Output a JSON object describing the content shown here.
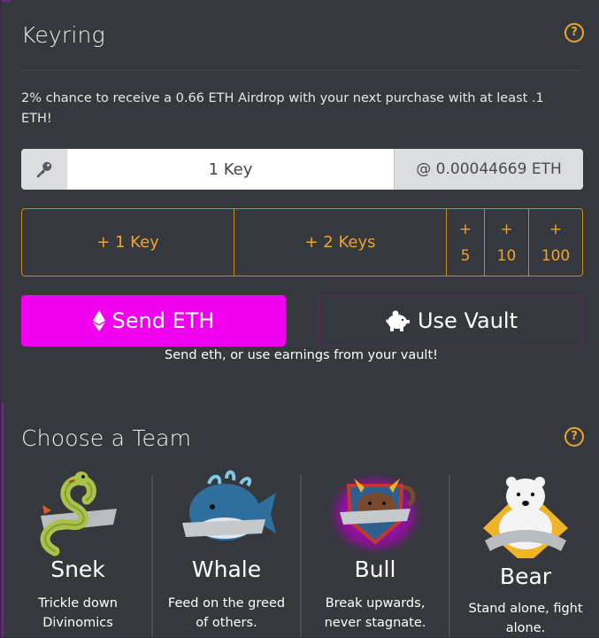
{
  "keyring": {
    "title": "Keyring",
    "help_icon": "question-circle-icon",
    "airdrop_text": "2% chance to receive a 0.66 ETH Airdrop with your next purchase with at least .1 ETH!",
    "key_icon": "key-icon",
    "key_input_value": "1 Key",
    "price_text": "@ 0.00044669 ETH",
    "add_buttons": {
      "one": "+ 1 Key",
      "two": "+ 2 Keys",
      "five_plus": "+",
      "five_num": "5",
      "ten_plus": "+",
      "ten_num": "10",
      "hundred_plus": "+",
      "hundred_num": "100"
    },
    "send_button": "Send ETH",
    "vault_button": "Use Vault",
    "send_note": "Send eth, or use earnings from your vault!"
  },
  "team": {
    "title": "Choose a Team",
    "help_icon": "question-circle-icon",
    "teams": [
      {
        "name": "Snek",
        "desc": "Trickle down Divinomics"
      },
      {
        "name": "Whale",
        "desc": "Feed on the greed of others."
      },
      {
        "name": "Bull",
        "desc": "Break upwards, never stagnate."
      },
      {
        "name": "Bear",
        "desc": "Stand alone, fight alone."
      }
    ]
  },
  "colors": {
    "background": "#35383d",
    "accent_orange": "#f0a429",
    "send_magenta": "#f000ef"
  }
}
